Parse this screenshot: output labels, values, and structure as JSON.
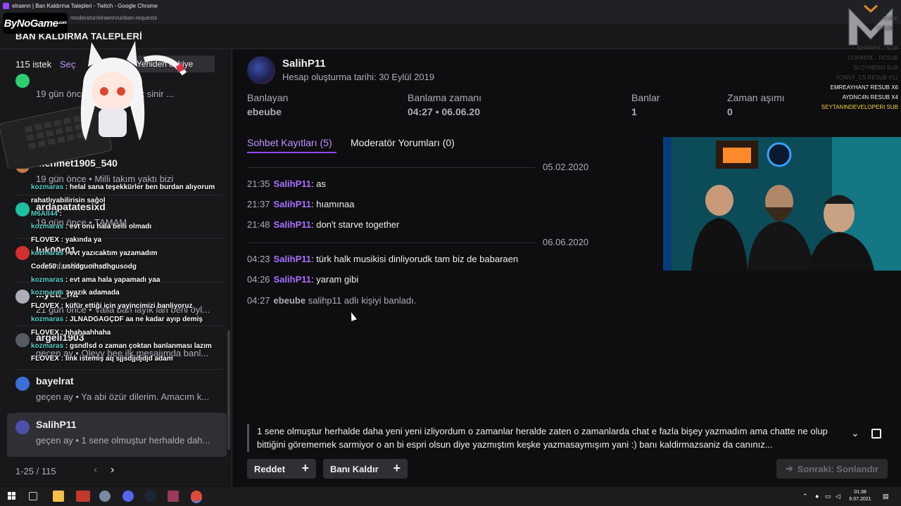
{
  "window": {
    "title": "elraenn | Ban Kaldırma Talepleri - Twitch - Google Chrome",
    "url": "moderator/elraenn/unban-requests"
  },
  "overlay_logo": {
    "text": "ByNoGame",
    "suffix": ".com"
  },
  "page": {
    "title": "BAN KALDIRMA TALEPLERİ"
  },
  "left": {
    "count_label": "115 istek",
    "select_label": "Seç",
    "sort_label": "Yeniden eskiye",
    "items": [
      {
        "name": "",
        "meta": "19 gün önce • ...arpsın çok sinir ...",
        "avatar_color": "#2ecc71"
      },
      {
        "name": "",
        "meta": "...vilad d...",
        "avatar_color": "#888888"
      },
      {
        "name": "mehmet1905_540",
        "meta": "19 gün önce • Milli takım yaktı bizi",
        "avatar_color": "#c07a4a"
      },
      {
        "name": "ardapatatesixd",
        "meta": "19 gün önce • TAMAM",
        "avatar_color": "#1fbfa0"
      },
      {
        "name": "luk00r01",
        "meta": "...banlandım muc...",
        "avatar_color": "#d03030"
      },
      {
        "name": "...yeti_ha",
        "meta": "21 gün önce • Valla ban layık lan beni öyl...",
        "avatar_color": "#adadb8"
      },
      {
        "name": "argeli1903",
        "meta": "geçen ay • Oleyy bee ilk mesajımda banl...",
        "avatar_color": "#5a5a66"
      },
      {
        "name": "bayelrat",
        "meta": "geçen ay • Ya abi özür dilerim. Amacım k...",
        "avatar_color": "#3b6fd6"
      },
      {
        "name": "SalihP11",
        "meta": "geçen ay • 1 sene olmuştur herhalde dah...",
        "avatar_color": "#4a4fa8"
      }
    ],
    "pager": {
      "range": "1-25 / 115",
      "prev": "‹",
      "next": "›"
    }
  },
  "chat_overlay": [
    {
      "name": "kozmaras",
      "msg": "helal sana teşekkürler ben burdan alıyorum"
    },
    {
      "name": "",
      "msg": "rahatlıyabilirisin sağol"
    },
    {
      "name": "M6All44",
      "msg": ""
    },
    {
      "name": "kozmaras",
      "msg": "evt onu hala belli olmadı"
    },
    {
      "name": "FLOVEX",
      "msg": "yakında ya",
      "white": true
    },
    {
      "name": "kozmaras",
      "msg": "evt yazıcaktım yazamadım"
    },
    {
      "name": "Code50",
      "msg": "ushdguoihsdhgusodg",
      "white": true
    },
    {
      "name": "kozmaras",
      "msg": "evt ama hala yapamadı yaa"
    },
    {
      "name": "kozmaras",
      "msg": "yazık adamada"
    },
    {
      "name": "FLOVEX",
      "msg": "küfür ettiği için yayincimizi banliyoruz",
      "white": true
    },
    {
      "name": "kozmaras",
      "msg": "JLNADGAGÇDF aa ne kadar ayıp demiş"
    },
    {
      "name": "FLOVEX",
      "msg": "hhahaahhaha",
      "white": true
    },
    {
      "name": "kozmaras",
      "msg": "gsndlsd o zaman çoktan banlanması lazım"
    },
    {
      "name": "FLOVEX",
      "msg": "link istemiş aq sjjsdjjdjdjd adam",
      "white": true
    }
  ],
  "detail": {
    "username": "SalihP11",
    "created": "Hesap oluşturma tarihi: 30 Eylül 2019",
    "stats": [
      {
        "label": "Banlayan",
        "value": "ebeube"
      },
      {
        "label": "Banlama zamanı",
        "value": "04:27 • 06.06.20"
      },
      {
        "label": "Banlar",
        "value": "1"
      },
      {
        "label": "Zaman aşımı",
        "value": "0"
      }
    ],
    "tabs": [
      {
        "label": "Sohbet Kayıtları (5)"
      },
      {
        "label": "Moderatör Yorumları (0)"
      }
    ],
    "dates": [
      "05.02.2020",
      "06.06.2020"
    ],
    "log": [
      {
        "time": "21:35",
        "user": "SalihP11",
        "msg": ": as"
      },
      {
        "time": "21:37",
        "user": "SalihP11",
        "msg": ": hıamınaa"
      },
      {
        "time": "21:48",
        "user": "SalihP11",
        "msg": ": don't starve together"
      },
      {
        "time": "04:23",
        "user": "SalihP11",
        "msg": ": türk halk musikisi dinliyorudk tam biz de babaraen"
      },
      {
        "time": "04:26",
        "user": "SalihP11",
        "msg": ": yaram gibi"
      },
      {
        "time": "04:27",
        "user": "ebeube",
        "msg": "salihp11 adlı kişiyi banladı."
      }
    ],
    "appeal": "1 sene olmuştur herhalde daha yeni yeni izliyordum o zamanlar heralde zaten o zamanlarda chat e fazla bişey yazmadım ama chatte ne olup bittiğini görememek sarmiyor o an bi espri olsun diye yazmıştım keşke yazmasaymışım yani :) banı kaldirmazsaniz da canınız...",
    "buttons": {
      "deny": "Reddet",
      "unban": "Banı Kaldır",
      "next": "Sonraki: Sonlandır"
    }
  },
  "alerts": [
    {
      "text": "TURK",
      "style": "faded"
    },
    {
      "text": "CAGR...",
      "style": "faded"
    },
    {
      "text": "...",
      "style": "faded"
    },
    {
      "text": "SHARPH... SUB",
      "style": "faded"
    },
    {
      "text": "GORKEM... RESUB",
      "style": "faded"
    },
    {
      "text": "SLOYMERN SUB",
      "style": "faded"
    },
    {
      "text": "TONNY_CS RESUB X11",
      "style": "faded"
    },
    {
      "text": "EMREAYHAN7 RESUB X6",
      "style": "normal"
    },
    {
      "text": "AYDNC4N RESUB X4",
      "style": "normal"
    },
    {
      "text": "SEYTANINDEVELOPERI SUB",
      "style": "hl"
    }
  ],
  "taskbar": {
    "time": "01:38",
    "date": "6.07.2021"
  },
  "colors": {
    "accent": "#9147ff",
    "accent_text": "#bf94ff",
    "background": "#0e0e10",
    "panel": "#18181b"
  }
}
